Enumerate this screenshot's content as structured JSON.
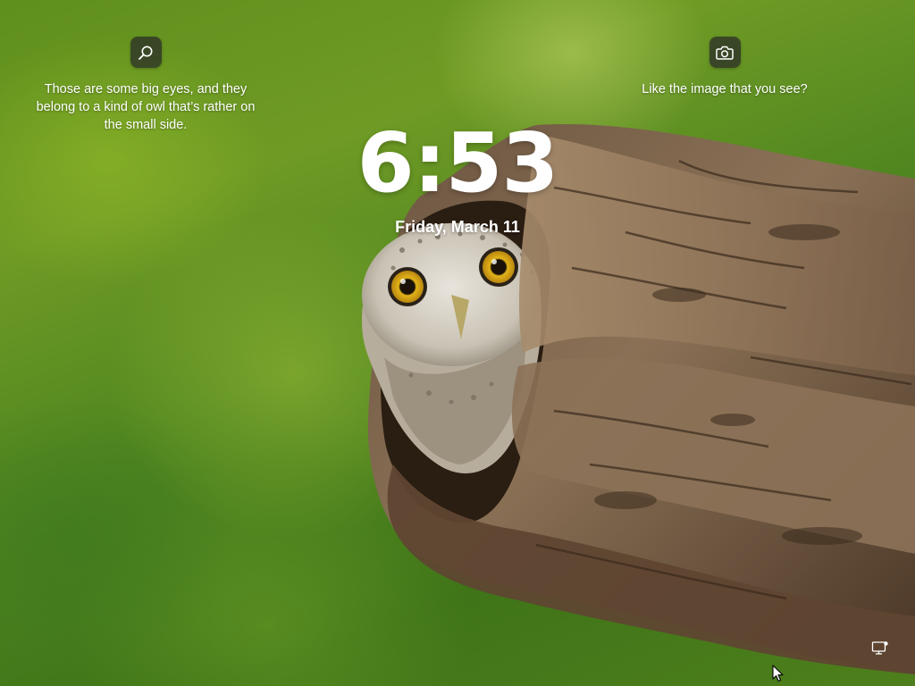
{
  "lockscreen": {
    "time": "6:53",
    "date": "Friday, March 11",
    "left_info": {
      "icon": "search-icon",
      "text": "Those are some big eyes, and they belong to a kind of owl that’s rather on the small side."
    },
    "right_info": {
      "icon": "camera-icon",
      "text": "Like the image that you see?"
    },
    "status_icons": [
      "network-icon"
    ],
    "colors": {
      "text": "#ffffff",
      "button_bg": "#282828",
      "background_primary": "#5f8f1c"
    }
  }
}
